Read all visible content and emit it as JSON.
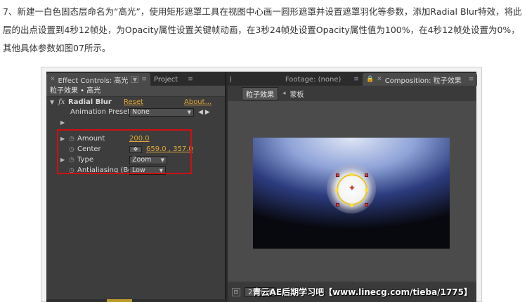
{
  "article": {
    "paragraph": "7、新建一白色固态层命名为“高光”，使用矩形遮罩工具在视图中心画一圆形遮罩并设置遮罩羽化等参数，添加Radial Blur特效，将此层的出点设置到4秒12帧处，为Opacity属性设置关键帧动画，在3秒24帧处设置Opacity属性值为100%，在4秒12帧处设置为0%，其他具体参数如图07所示。"
  },
  "left_panel": {
    "tab_effect": "Effect Controls: 高光",
    "tab_project": "Project",
    "breadcrumb": "粒子效果 • 高光",
    "effect": {
      "fx_label": "fx",
      "name": "Radial Blur",
      "reset": "Reset",
      "about": "About...",
      "presets_label": "Animation Presets:",
      "presets_value": "None",
      "presets_arrows": "◀ ▶"
    },
    "props": [
      {
        "label": "Amount",
        "value": "200.0"
      },
      {
        "label": "Center",
        "value": "659.0 , 357.0"
      },
      {
        "label": "Type",
        "value": "Zoom"
      },
      {
        "label": "Antialiasing (Be",
        "value": "Low"
      }
    ]
  },
  "right_panel": {
    "tab_footage": "Footage: (none)",
    "tab_composition": "Composition: 粒子效果",
    "comp_chip": "粒子效果",
    "comp_sep": "◂",
    "comp_other": "蒙板",
    "zoom": "25%"
  },
  "watermark": "青云AE后期学习吧【www.linecg.com/tieba/1775】",
  "colors": {
    "highlight_box": "#d01010",
    "value_orange": "#e2a73a",
    "mask_ring": "#e6c51f"
  }
}
